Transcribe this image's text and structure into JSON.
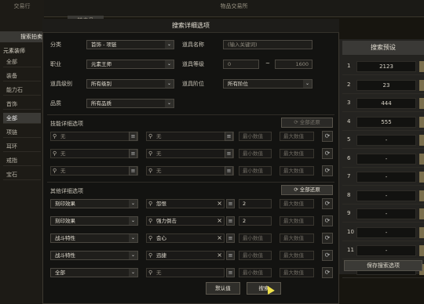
{
  "left": {
    "title": "交易行",
    "search_tab": "搜索拍卖",
    "section": "元素装师",
    "categories": [
      "全部",
      "装备",
      "能力石",
      "首饰",
      "全部",
      "项链",
      "耳环",
      "戒指",
      "宝石"
    ],
    "active_index": 4
  },
  "topbar": {
    "title": "物品交易所",
    "bg_tab": "拍卖品"
  },
  "dialog": {
    "title": "搜索详细选项",
    "fields": {
      "category_label": "分类",
      "category_value": "首饰 - 项链",
      "item_name_label": "道具名称",
      "item_name_placeholder": "(输入关键词)",
      "class_label": "职业",
      "class_value": "元素王师",
      "item_level_label": "道具等级",
      "level_min": "0",
      "level_sep": "~",
      "level_max": "1600",
      "grade_label": "道具级别",
      "grade_value": "所有级别",
      "tier_label": "道具阶位",
      "tier_value": "所有阶位",
      "quality_label": "品质",
      "quality_value": "所有品质"
    },
    "skill_section": {
      "title": "技能详细选项",
      "reset_label": "全部还原",
      "rows": [
        {
          "skill": "无",
          "effect": "无",
          "min": "最小数值",
          "max": "最大数值"
        },
        {
          "skill": "无",
          "effect": "无",
          "min": "最小数值",
          "max": "最大数值"
        },
        {
          "skill": "无",
          "effect": "无",
          "min": "最小数值",
          "max": "最大数值"
        }
      ]
    },
    "other_section": {
      "title": "其他详细选项",
      "reset_label": "全部还原",
      "rows": [
        {
          "type": "刻印效果",
          "effect": "怨恨",
          "min": "2",
          "max": "最大数值"
        },
        {
          "type": "刻印效果",
          "effect": "强力倒击",
          "min": "2",
          "max": "最大数值"
        },
        {
          "type": "战斗特性",
          "effect": "会心",
          "min": "最小数值",
          "max": "最大数值"
        },
        {
          "type": "战斗特性",
          "effect": "迅捷",
          "min": "最小数值",
          "max": "最大数值"
        },
        {
          "type": "全部",
          "effect": "无",
          "min": "最小数值",
          "max": "最大数值"
        }
      ]
    },
    "default_label": "默认值",
    "search_label": "搜索"
  },
  "presets": {
    "title": "搜索预设",
    "rows": [
      {
        "n": "1",
        "v": "2123"
      },
      {
        "n": "2",
        "v": "23"
      },
      {
        "n": "3",
        "v": "444"
      },
      {
        "n": "4",
        "v": "555"
      },
      {
        "n": "5",
        "v": "-"
      },
      {
        "n": "6",
        "v": "-"
      },
      {
        "n": "7",
        "v": "-"
      },
      {
        "n": "8",
        "v": "-"
      },
      {
        "n": "9",
        "v": "-"
      },
      {
        "n": "10",
        "v": "-"
      },
      {
        "n": "11",
        "v": "-"
      },
      {
        "n": "12",
        "v": "-"
      }
    ],
    "save_label": "保存搜索选项"
  }
}
